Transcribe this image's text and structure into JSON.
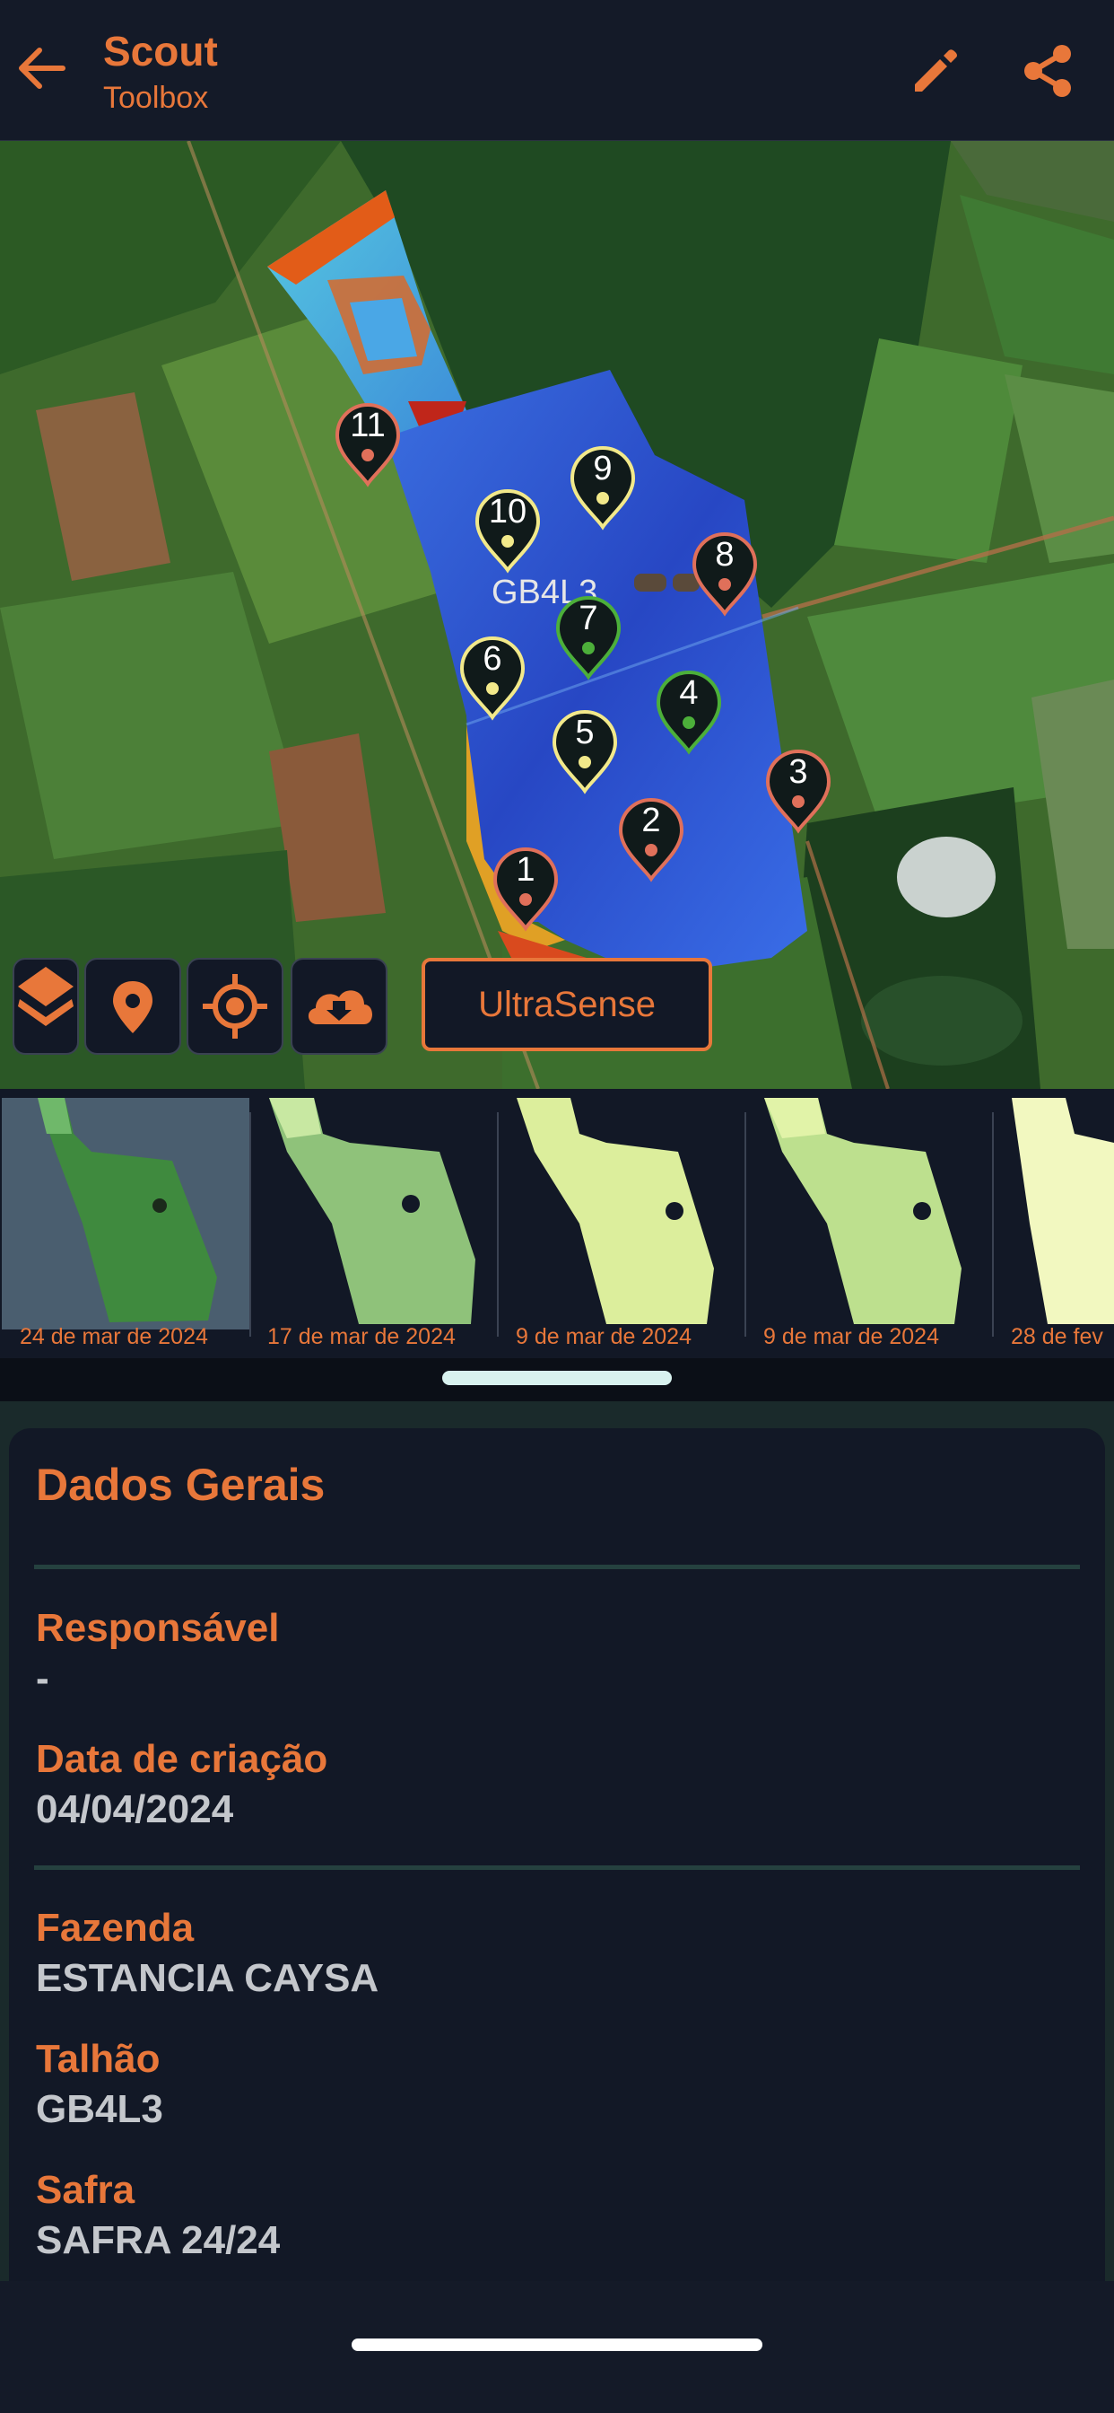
{
  "header": {
    "title": "Scout",
    "subtitle": "Toolbox",
    "back_icon": "arrow-left-icon",
    "edit_icon": "pencil-icon",
    "share_icon": "share-icon"
  },
  "map": {
    "field_label": "GB4L3",
    "pins": [
      {
        "num": "1",
        "color": "#e0705a"
      },
      {
        "num": "2",
        "color": "#e0705a"
      },
      {
        "num": "3",
        "color": "#e0705a"
      },
      {
        "num": "4",
        "color": "#4caf3a"
      },
      {
        "num": "5",
        "color": "#f2e98a"
      },
      {
        "num": "6",
        "color": "#f2e98a"
      },
      {
        "num": "7",
        "color": "#4caf3a"
      },
      {
        "num": "8",
        "color": "#e0705a"
      },
      {
        "num": "9",
        "color": "#f2e98a"
      },
      {
        "num": "10",
        "color": "#f2e98a"
      },
      {
        "num": "11",
        "color": "#e0705a"
      }
    ],
    "tools": {
      "layers_icon": "layers-icon",
      "pin_icon": "location-pin-icon",
      "locate_icon": "crosshair-icon",
      "download_icon": "cloud-download-icon"
    },
    "ultrasense_label": "UltraSense"
  },
  "thumbnails": [
    {
      "date": "24 de mar de 2024",
      "selected": true
    },
    {
      "date": "17 de mar de 2024"
    },
    {
      "date": "9 de mar de 2024"
    },
    {
      "date": "9 de mar de 2024"
    },
    {
      "date": "28 de fev"
    }
  ],
  "panel": {
    "title": "Dados Gerais",
    "fields": [
      {
        "label": "Responsável",
        "value": "-"
      },
      {
        "label": "Data de criação",
        "value": "04/04/2024"
      },
      {
        "label": "Fazenda",
        "value": "ESTANCIA CAYSA"
      },
      {
        "label": "Talhão",
        "value": "GB4L3"
      },
      {
        "label": "Safra",
        "value": "SAFRA 24/24"
      }
    ]
  },
  "colors": {
    "accent": "#e8773a",
    "background": "#121826",
    "pin_red": "#e0705a",
    "pin_yellow": "#f2e98a",
    "pin_green": "#4caf3a"
  }
}
